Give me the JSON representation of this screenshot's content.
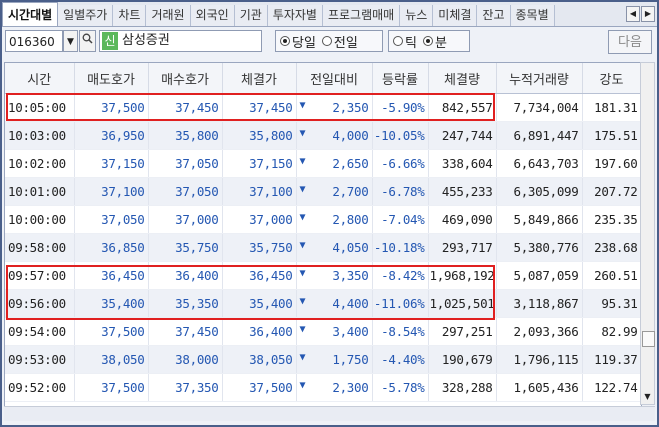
{
  "tabs": [
    "시간대별",
    "일별주가",
    "차트",
    "거래원",
    "외국인",
    "기관",
    "투자자별",
    "프로그램매매",
    "뉴스",
    "미체결",
    "잔고",
    "종목별"
  ],
  "active_tab": 0,
  "toolbar": {
    "stock_code": "016360",
    "badge": "신",
    "stock_name": "삼성증권",
    "day_options": [
      "당일",
      "전일"
    ],
    "day_selected": "당일",
    "unit_options": [
      "틱",
      "분"
    ],
    "unit_selected": "분",
    "next_label": "다음"
  },
  "table": {
    "columns": [
      "시간",
      "매도호가",
      "매수호가",
      "체결가",
      "전일대비",
      "등락률",
      "체결량",
      "누적거래량",
      "강도"
    ],
    "rows": [
      [
        "10:05:00",
        "37,500",
        "37,450",
        "37,450",
        "2,350",
        "-5.90%",
        "842,557",
        "7,734,004",
        "181.31"
      ],
      [
        "10:03:00",
        "36,950",
        "35,800",
        "35,800",
        "4,000",
        "-10.05%",
        "247,744",
        "6,891,447",
        "175.51"
      ],
      [
        "10:02:00",
        "37,150",
        "37,050",
        "37,150",
        "2,650",
        "-6.66%",
        "338,604",
        "6,643,703",
        "197.60"
      ],
      [
        "10:01:00",
        "37,100",
        "37,050",
        "37,100",
        "2,700",
        "-6.78%",
        "455,233",
        "6,305,099",
        "207.72"
      ],
      [
        "10:00:00",
        "37,050",
        "37,000",
        "37,000",
        "2,800",
        "-7.04%",
        "469,090",
        "5,849,866",
        "235.35"
      ],
      [
        "09:58:00",
        "36,850",
        "35,750",
        "35,750",
        "4,050",
        "-10.18%",
        "293,717",
        "5,380,776",
        "238.68"
      ],
      [
        "09:57:00",
        "36,450",
        "36,400",
        "36,450",
        "3,350",
        "-8.42%",
        "1,968,192",
        "5,087,059",
        "260.51"
      ],
      [
        "09:56:00",
        "35,400",
        "35,350",
        "35,400",
        "4,400",
        "-11.06%",
        "1,025,501",
        "3,118,867",
        "95.31"
      ],
      [
        "09:54:00",
        "37,500",
        "37,450",
        "36,400",
        "3,400",
        "-8.54%",
        "297,251",
        "2,093,366",
        "82.99"
      ],
      [
        "09:53:00",
        "38,050",
        "38,000",
        "38,050",
        "1,750",
        "-4.40%",
        "190,679",
        "1,796,115",
        "119.37"
      ],
      [
        "09:52:00",
        "37,500",
        "37,350",
        "37,500",
        "2,300",
        "-5.78%",
        "328,288",
        "1,605,436",
        "122.74"
      ]
    ],
    "change_arrow": "▼"
  },
  "colors": {
    "down": "#2457b2",
    "highlight": "#e02020",
    "frame": "#4a5f8a"
  }
}
